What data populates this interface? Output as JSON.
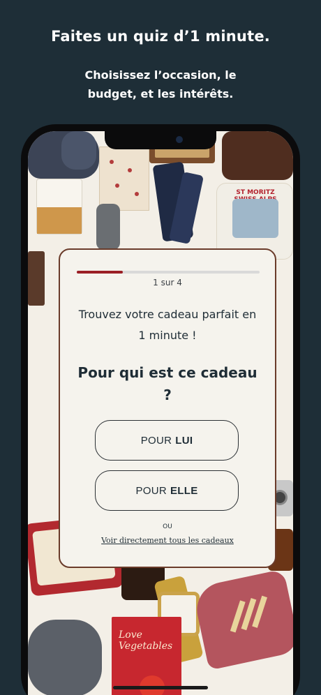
{
  "promo": {
    "headline": "Faites un quiz d’1 minute.",
    "subline": "Choisissez l’occasion, le budget, et les intérêts."
  },
  "collage": {
    "sweater_text": "ST MORITZ SWISS ALPS",
    "book_title": "Love Vegetables"
  },
  "quiz": {
    "progress_fraction": 0.25,
    "step_label": "1 sur 4",
    "intro": "Trouvez votre cadeau parfait en 1 minute !",
    "question": "Pour qui est ce cadeau ?",
    "choices": [
      {
        "prefix": "POUR",
        "label": "LUI"
      },
      {
        "prefix": "POUR",
        "label": "ELLE"
      }
    ],
    "or_label": "OU",
    "browse_link": "Voir directement tous les cadeaux"
  },
  "colors": {
    "background": "#1e2e37",
    "accent": "#9b1f25",
    "card_border": "#6a3b2a"
  }
}
